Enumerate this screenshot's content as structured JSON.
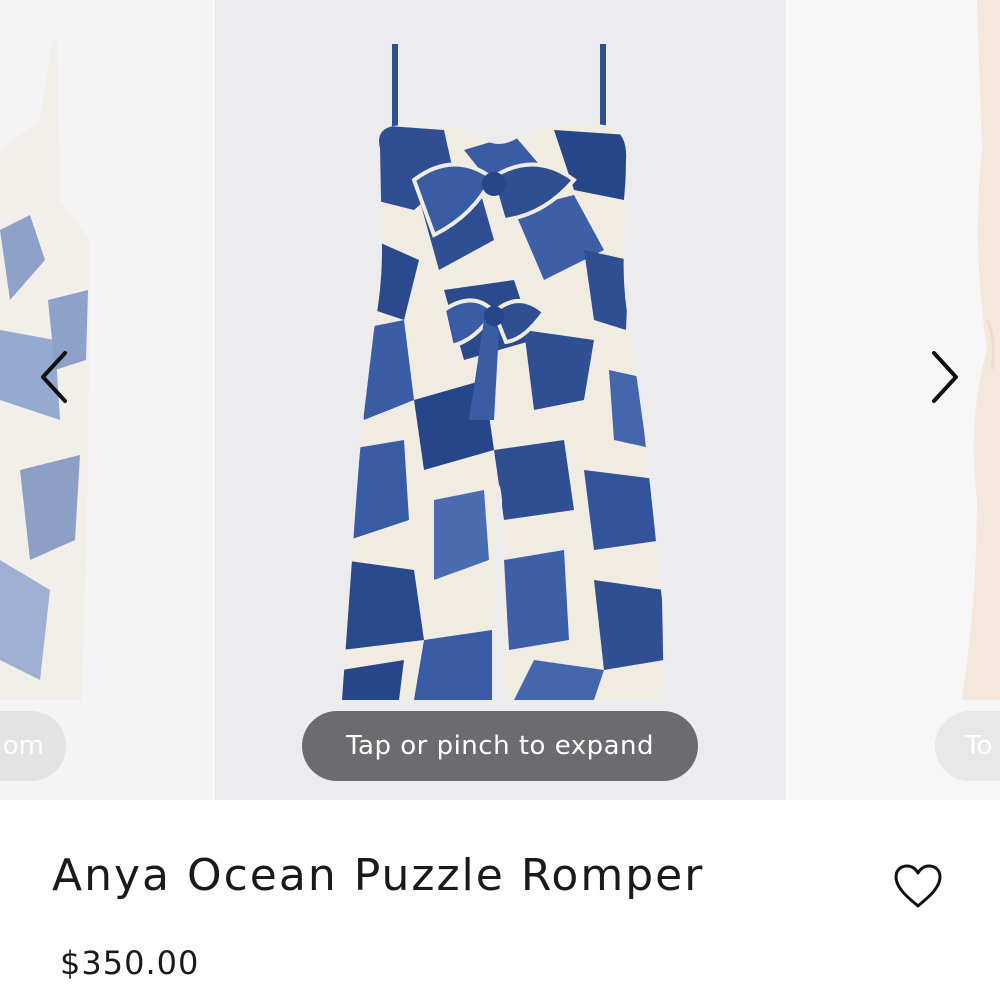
{
  "carousel": {
    "hint_label": "Tap or pinch to expand",
    "hint_left_partial": "om",
    "hint_right_partial": "To",
    "prev_icon": "chevron-left-icon",
    "next_icon": "chevron-right-icon"
  },
  "product": {
    "name": "Anya Ocean Puzzle Romper",
    "price": "$350.00",
    "wishlist_icon": "heart-outline-icon"
  },
  "colors": {
    "print_blue": "#2f4f92",
    "print_cream": "#f1ece2",
    "pill_bg": "#6c6c70",
    "text": "#1a1a1a"
  }
}
